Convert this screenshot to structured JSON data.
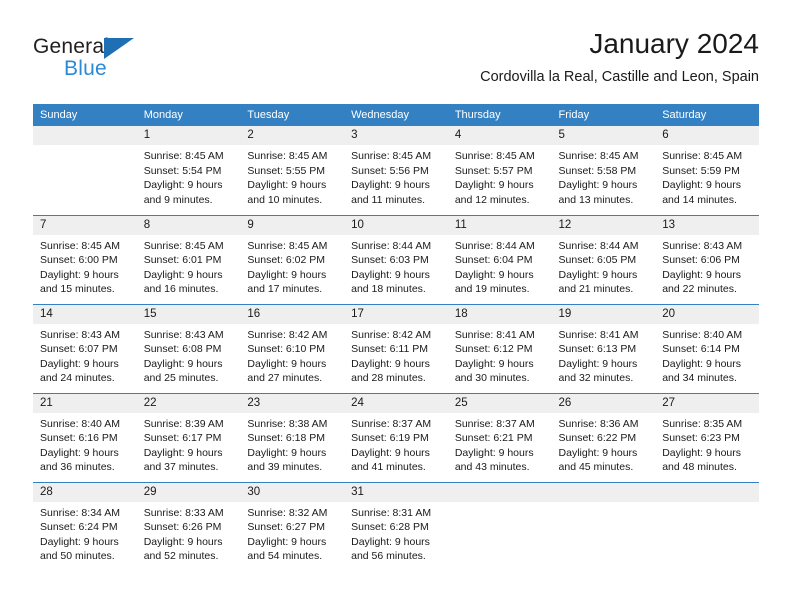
{
  "brand": {
    "name_part1": "General",
    "name_part2": "Blue",
    "triangle_color": "#1f6fb5",
    "blue_color": "#2b8ad6"
  },
  "header": {
    "title": "January 2024",
    "location": "Cordovilla la Real, Castille and Leon, Spain"
  },
  "theme": {
    "header_bg": "#3380c2",
    "daynum_bg": "#efefef",
    "text": "#1a1a1a"
  },
  "weekdays": [
    "Sunday",
    "Monday",
    "Tuesday",
    "Wednesday",
    "Thursday",
    "Friday",
    "Saturday"
  ],
  "weeks": [
    [
      {
        "day": "",
        "sunrise": "",
        "sunset": "",
        "daylight1": "",
        "daylight2": ""
      },
      {
        "day": "1",
        "sunrise": "Sunrise: 8:45 AM",
        "sunset": "Sunset: 5:54 PM",
        "daylight1": "Daylight: 9 hours",
        "daylight2": "and 9 minutes."
      },
      {
        "day": "2",
        "sunrise": "Sunrise: 8:45 AM",
        "sunset": "Sunset: 5:55 PM",
        "daylight1": "Daylight: 9 hours",
        "daylight2": "and 10 minutes."
      },
      {
        "day": "3",
        "sunrise": "Sunrise: 8:45 AM",
        "sunset": "Sunset: 5:56 PM",
        "daylight1": "Daylight: 9 hours",
        "daylight2": "and 11 minutes."
      },
      {
        "day": "4",
        "sunrise": "Sunrise: 8:45 AM",
        "sunset": "Sunset: 5:57 PM",
        "daylight1": "Daylight: 9 hours",
        "daylight2": "and 12 minutes."
      },
      {
        "day": "5",
        "sunrise": "Sunrise: 8:45 AM",
        "sunset": "Sunset: 5:58 PM",
        "daylight1": "Daylight: 9 hours",
        "daylight2": "and 13 minutes."
      },
      {
        "day": "6",
        "sunrise": "Sunrise: 8:45 AM",
        "sunset": "Sunset: 5:59 PM",
        "daylight1": "Daylight: 9 hours",
        "daylight2": "and 14 minutes."
      }
    ],
    [
      {
        "day": "7",
        "sunrise": "Sunrise: 8:45 AM",
        "sunset": "Sunset: 6:00 PM",
        "daylight1": "Daylight: 9 hours",
        "daylight2": "and 15 minutes."
      },
      {
        "day": "8",
        "sunrise": "Sunrise: 8:45 AM",
        "sunset": "Sunset: 6:01 PM",
        "daylight1": "Daylight: 9 hours",
        "daylight2": "and 16 minutes."
      },
      {
        "day": "9",
        "sunrise": "Sunrise: 8:45 AM",
        "sunset": "Sunset: 6:02 PM",
        "daylight1": "Daylight: 9 hours",
        "daylight2": "and 17 minutes."
      },
      {
        "day": "10",
        "sunrise": "Sunrise: 8:44 AM",
        "sunset": "Sunset: 6:03 PM",
        "daylight1": "Daylight: 9 hours",
        "daylight2": "and 18 minutes."
      },
      {
        "day": "11",
        "sunrise": "Sunrise: 8:44 AM",
        "sunset": "Sunset: 6:04 PM",
        "daylight1": "Daylight: 9 hours",
        "daylight2": "and 19 minutes."
      },
      {
        "day": "12",
        "sunrise": "Sunrise: 8:44 AM",
        "sunset": "Sunset: 6:05 PM",
        "daylight1": "Daylight: 9 hours",
        "daylight2": "and 21 minutes."
      },
      {
        "day": "13",
        "sunrise": "Sunrise: 8:43 AM",
        "sunset": "Sunset: 6:06 PM",
        "daylight1": "Daylight: 9 hours",
        "daylight2": "and 22 minutes."
      }
    ],
    [
      {
        "day": "14",
        "sunrise": "Sunrise: 8:43 AM",
        "sunset": "Sunset: 6:07 PM",
        "daylight1": "Daylight: 9 hours",
        "daylight2": "and 24 minutes."
      },
      {
        "day": "15",
        "sunrise": "Sunrise: 8:43 AM",
        "sunset": "Sunset: 6:08 PM",
        "daylight1": "Daylight: 9 hours",
        "daylight2": "and 25 minutes."
      },
      {
        "day": "16",
        "sunrise": "Sunrise: 8:42 AM",
        "sunset": "Sunset: 6:10 PM",
        "daylight1": "Daylight: 9 hours",
        "daylight2": "and 27 minutes."
      },
      {
        "day": "17",
        "sunrise": "Sunrise: 8:42 AM",
        "sunset": "Sunset: 6:11 PM",
        "daylight1": "Daylight: 9 hours",
        "daylight2": "and 28 minutes."
      },
      {
        "day": "18",
        "sunrise": "Sunrise: 8:41 AM",
        "sunset": "Sunset: 6:12 PM",
        "daylight1": "Daylight: 9 hours",
        "daylight2": "and 30 minutes."
      },
      {
        "day": "19",
        "sunrise": "Sunrise: 8:41 AM",
        "sunset": "Sunset: 6:13 PM",
        "daylight1": "Daylight: 9 hours",
        "daylight2": "and 32 minutes."
      },
      {
        "day": "20",
        "sunrise": "Sunrise: 8:40 AM",
        "sunset": "Sunset: 6:14 PM",
        "daylight1": "Daylight: 9 hours",
        "daylight2": "and 34 minutes."
      }
    ],
    [
      {
        "day": "21",
        "sunrise": "Sunrise: 8:40 AM",
        "sunset": "Sunset: 6:16 PM",
        "daylight1": "Daylight: 9 hours",
        "daylight2": "and 36 minutes."
      },
      {
        "day": "22",
        "sunrise": "Sunrise: 8:39 AM",
        "sunset": "Sunset: 6:17 PM",
        "daylight1": "Daylight: 9 hours",
        "daylight2": "and 37 minutes."
      },
      {
        "day": "23",
        "sunrise": "Sunrise: 8:38 AM",
        "sunset": "Sunset: 6:18 PM",
        "daylight1": "Daylight: 9 hours",
        "daylight2": "and 39 minutes."
      },
      {
        "day": "24",
        "sunrise": "Sunrise: 8:37 AM",
        "sunset": "Sunset: 6:19 PM",
        "daylight1": "Daylight: 9 hours",
        "daylight2": "and 41 minutes."
      },
      {
        "day": "25",
        "sunrise": "Sunrise: 8:37 AM",
        "sunset": "Sunset: 6:21 PM",
        "daylight1": "Daylight: 9 hours",
        "daylight2": "and 43 minutes."
      },
      {
        "day": "26",
        "sunrise": "Sunrise: 8:36 AM",
        "sunset": "Sunset: 6:22 PM",
        "daylight1": "Daylight: 9 hours",
        "daylight2": "and 45 minutes."
      },
      {
        "day": "27",
        "sunrise": "Sunrise: 8:35 AM",
        "sunset": "Sunset: 6:23 PM",
        "daylight1": "Daylight: 9 hours",
        "daylight2": "and 48 minutes."
      }
    ],
    [
      {
        "day": "28",
        "sunrise": "Sunrise: 8:34 AM",
        "sunset": "Sunset: 6:24 PM",
        "daylight1": "Daylight: 9 hours",
        "daylight2": "and 50 minutes."
      },
      {
        "day": "29",
        "sunrise": "Sunrise: 8:33 AM",
        "sunset": "Sunset: 6:26 PM",
        "daylight1": "Daylight: 9 hours",
        "daylight2": "and 52 minutes."
      },
      {
        "day": "30",
        "sunrise": "Sunrise: 8:32 AM",
        "sunset": "Sunset: 6:27 PM",
        "daylight1": "Daylight: 9 hours",
        "daylight2": "and 54 minutes."
      },
      {
        "day": "31",
        "sunrise": "Sunrise: 8:31 AM",
        "sunset": "Sunset: 6:28 PM",
        "daylight1": "Daylight: 9 hours",
        "daylight2": "and 56 minutes."
      },
      {
        "day": "",
        "sunrise": "",
        "sunset": "",
        "daylight1": "",
        "daylight2": ""
      },
      {
        "day": "",
        "sunrise": "",
        "sunset": "",
        "daylight1": "",
        "daylight2": ""
      },
      {
        "day": "",
        "sunrise": "",
        "sunset": "",
        "daylight1": "",
        "daylight2": ""
      }
    ]
  ]
}
